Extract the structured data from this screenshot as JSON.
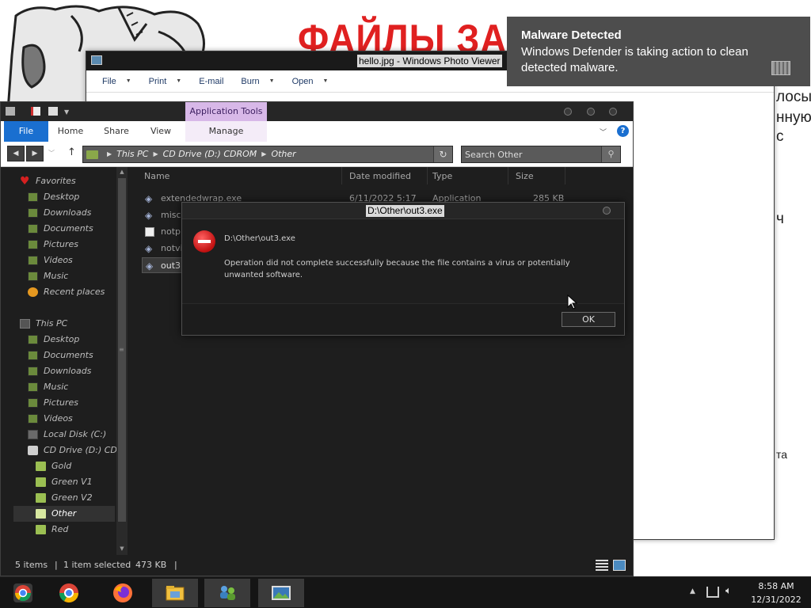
{
  "wallpaper": {
    "headline": "ФАЙЛЫ ЗА",
    "side_lines": [
      "лосы",
      "нную",
      "с",
      "ч",
      "та"
    ]
  },
  "photo_viewer": {
    "title": "hello.jpg - Windows Photo Viewer",
    "menu": [
      "File",
      "Print",
      "E-mail",
      "Burn",
      "Open"
    ]
  },
  "explorer": {
    "contextual_tab": "Application Tools",
    "tabs": {
      "file": "File",
      "home": "Home",
      "share": "Share",
      "view": "View",
      "manage": "Manage"
    },
    "address": [
      "This PC",
      "CD Drive (D:) CDROM",
      "Other"
    ],
    "search_placeholder": "Search Other",
    "columns": {
      "name": "Name",
      "date": "Date modified",
      "type": "Type",
      "size": "Size"
    },
    "files": [
      {
        "name": "extendedwrap.exe",
        "date": "6/11/2022 5:17",
        "type": "Application",
        "size": "285 KB"
      },
      {
        "name": "misc",
        "date": "",
        "type": "",
        "size": ""
      },
      {
        "name": "notp",
        "date": "",
        "type": "",
        "size": ""
      },
      {
        "name": "notvi",
        "date": "",
        "type": "",
        "size": ""
      },
      {
        "name": "out3.",
        "date": "",
        "type": "",
        "size": ""
      }
    ],
    "nav": {
      "favorites": "Favorites",
      "fav_items": [
        "Desktop",
        "Downloads",
        "Documents",
        "Pictures",
        "Videos",
        "Music",
        "Recent places"
      ],
      "this_pc": "This PC",
      "pc_items": [
        "Desktop",
        "Documents",
        "Downloads",
        "Music",
        "Pictures",
        "Videos",
        "Local Disk (C:)",
        "CD Drive (D:) CDR"
      ],
      "cd_folders": [
        "Gold",
        "Green V1",
        "Green V2",
        "Other",
        "Red"
      ]
    },
    "status": {
      "count": "5 items",
      "selected": "1 item selected",
      "size": "473 KB"
    }
  },
  "dialog": {
    "title": "D:\\Other\\out3.exe",
    "path": "D:\\Other\\out3.exe",
    "message": "Operation did not complete successfully because the file contains a virus or potentially unwanted software.",
    "ok": "OK"
  },
  "toast": {
    "title": "Malware Detected",
    "body": "Windows Defender is taking action to clean detected malware."
  },
  "taskbar": {
    "apps": [
      "chrome-legacy",
      "chrome",
      "firefox",
      "file-explorer",
      "network-users",
      "photo-viewer"
    ],
    "time": "8:58 AM",
    "date": "12/31/2022"
  }
}
